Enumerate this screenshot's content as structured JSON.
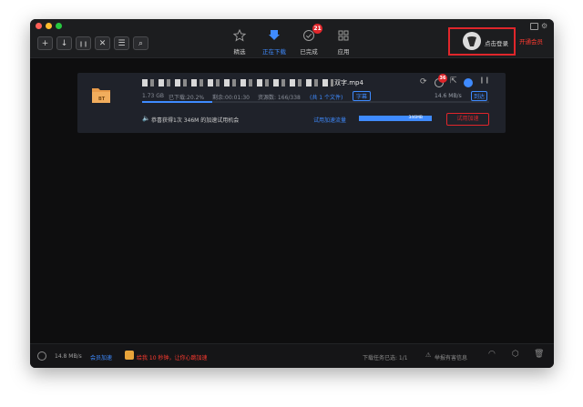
{
  "toolbar": {
    "buttons": [
      {
        "name": "add-button",
        "glyph": "+"
      },
      {
        "name": "start-button",
        "glyph": "↓"
      },
      {
        "name": "pause-button",
        "glyph": "❙❙"
      },
      {
        "name": "delete-button",
        "glyph": "✕"
      },
      {
        "name": "list-button",
        "glyph": "☰"
      },
      {
        "name": "search-button",
        "glyph": "⌕"
      }
    ]
  },
  "tabs": [
    {
      "label": "精选",
      "icon": "star-icon",
      "active": false
    },
    {
      "label": "正在下载",
      "icon": "download-icon",
      "active": true
    },
    {
      "label": "已完成",
      "icon": "check-icon",
      "active": false,
      "badge": "21"
    },
    {
      "label": "应用",
      "icon": "apps-grid-icon",
      "active": false
    }
  ],
  "account": {
    "login_label": "点击登录",
    "vip_label": "开通会员"
  },
  "download": {
    "file_badge": "BT",
    "filename_suffix": "双字.mp4",
    "size": "1.73 GB",
    "progress_text": "已下载:20.2%",
    "remaining": "剩余:00:01:30",
    "resources": "资源数: 166/338",
    "file_count": "(共 1 个文件)",
    "subtitle_tag": "字幕",
    "speed": "14.6 MB/s",
    "status_tag": "到达",
    "progress": 0.202,
    "action_badge": "36"
  },
  "trial": {
    "message": "恭喜获得1次 346M 的加速试用机会",
    "flow_label": "试用加速流量",
    "flow_value": "346MB",
    "button_label": "试用加速"
  },
  "status": {
    "speed": "14.8 MB/s",
    "vip_speed": "会员加速",
    "promo": "给我 10 秒钟，让你心跳加速",
    "tasks": "下载任务已选: 1/1",
    "report": "举报有害信息"
  },
  "colors": {
    "accent": "#3f8bff",
    "alert": "#e0262b",
    "background": "#0e0e0f"
  }
}
